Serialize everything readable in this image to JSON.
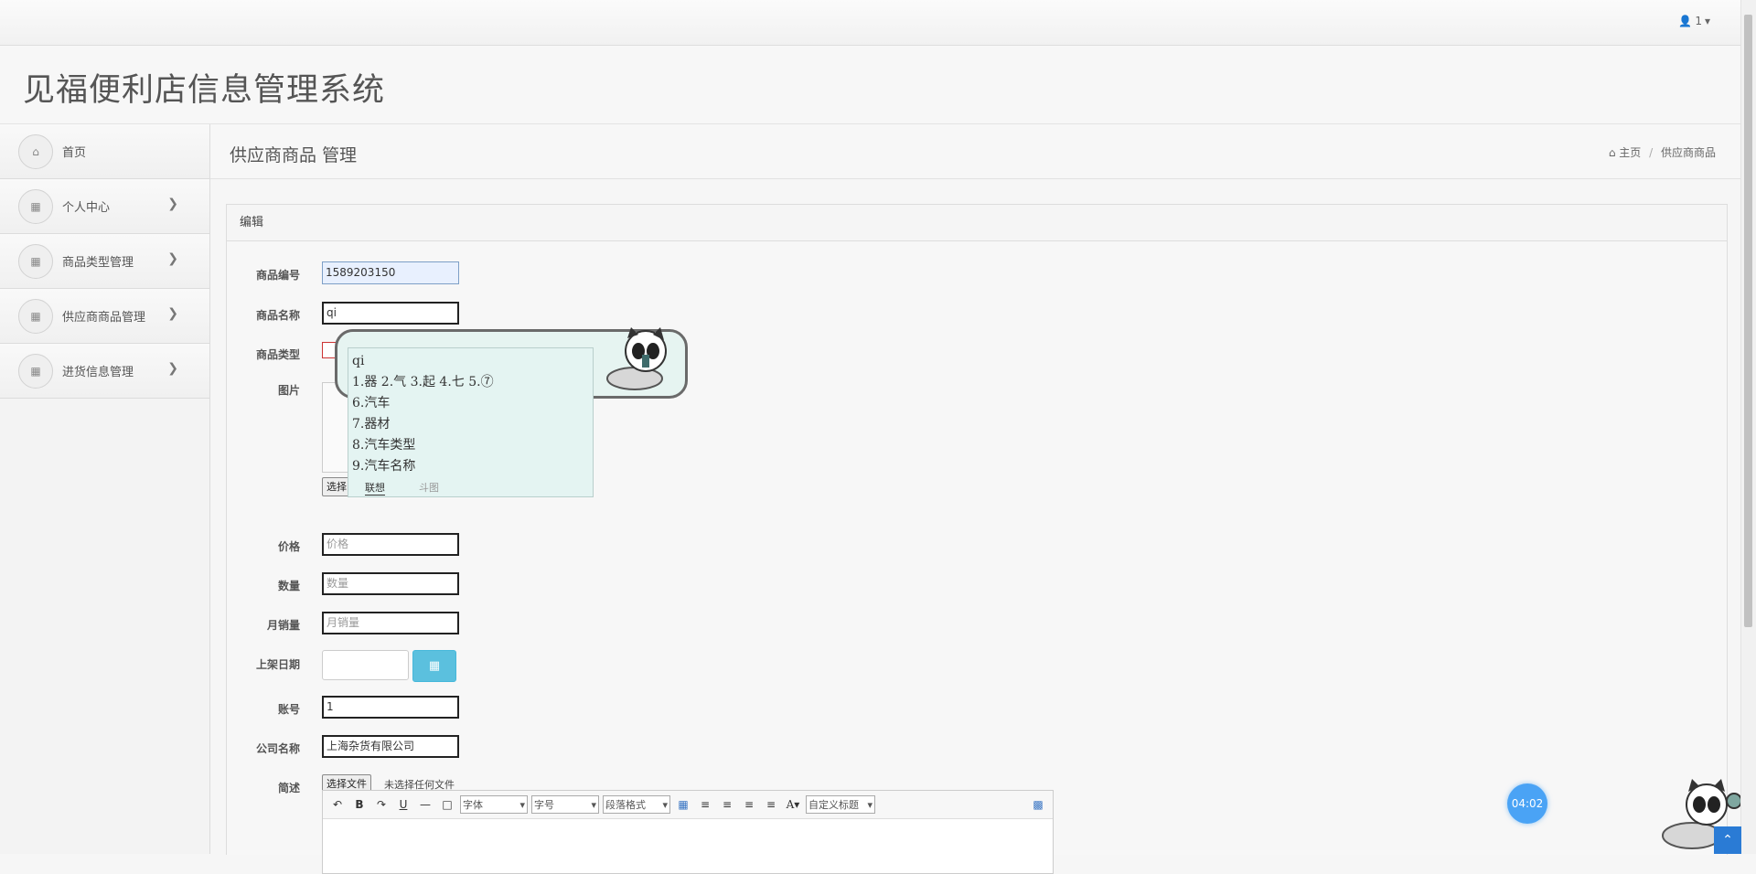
{
  "topbar": {
    "user_label": "1"
  },
  "app": {
    "title": "见福便利店信息管理系统"
  },
  "sidebar": {
    "items": [
      {
        "label": "首页",
        "icon": "home-icon",
        "has_arrow": false
      },
      {
        "label": "个人中心",
        "icon": "grid-icon",
        "has_arrow": true
      },
      {
        "label": "商品类型管理",
        "icon": "grid-icon",
        "has_arrow": true
      },
      {
        "label": "供应商商品管理",
        "icon": "grid-icon",
        "has_arrow": true
      },
      {
        "label": "进货信息管理",
        "icon": "grid-icon",
        "has_arrow": true
      }
    ]
  },
  "page": {
    "title": "供应商商品 管理",
    "breadcrumb": {
      "home": "主页",
      "current": "供应商商品"
    }
  },
  "panel": {
    "heading": "编辑"
  },
  "form": {
    "code_label": "商品编号",
    "code_value": "1589203150",
    "name_label": "商品名称",
    "name_value": "qi",
    "type_label": "商品类型",
    "image_label": "图片",
    "image_choose": "选择",
    "price_label": "价格",
    "price_placeholder": "价格",
    "qty_label": "数量",
    "qty_placeholder": "数量",
    "monthly_label": "月销量",
    "monthly_placeholder": "月销量",
    "date_label": "上架日期",
    "account_label": "账号",
    "account_value": "1",
    "company_label": "公司名称",
    "company_value": "上海杂货有限公司",
    "desc_label": "简述",
    "desc_choose": "选择文件",
    "desc_status": "未选择任何文件"
  },
  "editor": {
    "font_select": "字体",
    "size_select": "字号",
    "para_select": "段落格式",
    "title_select": "自定义标题"
  },
  "ime": {
    "input": "qi",
    "row1": "1.器 2.气 3.起 4.七 5.⑦",
    "candidates": [
      "6.汽车",
      "7.器材",
      "8.汽车类型",
      "9.汽车名称"
    ],
    "tab_active": "联想",
    "tab_other": "斗图"
  },
  "timer": {
    "value": "04:02"
  },
  "colors": {
    "accent": "#5bc0de",
    "timer": "#4aa3f5",
    "ime_bg": "#e4f4f2"
  }
}
